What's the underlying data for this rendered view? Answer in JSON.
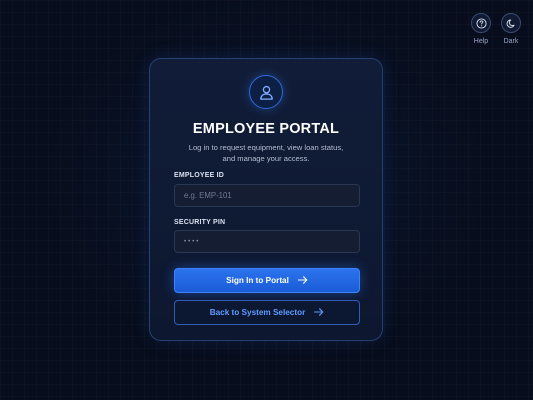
{
  "top_tools": {
    "help_label": "Help",
    "dark_label": "Dark"
  },
  "login": {
    "title": "EMPLOYEE PORTAL",
    "subtitle_line1": "Log in to request equipment, view loan status,",
    "subtitle_line2": "and manage your access.",
    "employee_id_label": "EMPLOYEE ID",
    "employee_id_placeholder": "e.g. EMP-101",
    "pin_label": "SECURITY PIN",
    "pin_placeholder": "••••",
    "sign_in_label": "Sign In to Portal",
    "back_label": "Back to System Selector"
  },
  "colors": {
    "background": "#070d1c",
    "card": "#111d38",
    "accent": "#2c73ee",
    "accent_text": "#5f9bff"
  },
  "icons": [
    "help-icon",
    "moon-icon",
    "user-icon",
    "arrow-right-icon"
  ]
}
